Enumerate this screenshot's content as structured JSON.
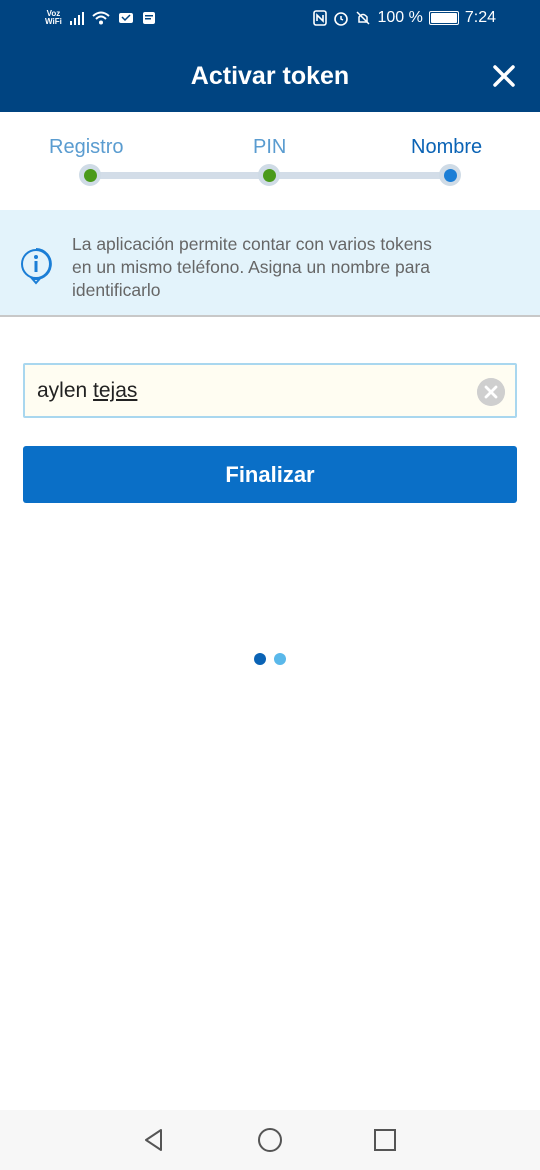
{
  "status_bar": {
    "carrier_label_1": "Voz",
    "carrier_label_2": "WiFi",
    "battery": "100 %",
    "time": "7:24"
  },
  "header": {
    "title": "Activar token",
    "close_icon": "close-icon"
  },
  "stepper": {
    "steps": [
      {
        "label": "Registro",
        "state": "done",
        "color": "#4a9a1a"
      },
      {
        "label": "PIN",
        "state": "done",
        "color": "#4a9a1a"
      },
      {
        "label": "Nombre",
        "state": "current",
        "color": "#1b7ed6"
      }
    ]
  },
  "info": {
    "icon": "info-icon",
    "message_line1": "La aplicación permite contar con varios tokens",
    "message_line2": "en un mismo teléfono. Asigna un nombre para",
    "message_line3": "identificarlo"
  },
  "name_field": {
    "value_word1": "aylen",
    "value_word2": "tejas",
    "clear_icon": "clear-icon"
  },
  "finalize_button": {
    "label": "Finalizar"
  },
  "loader": {
    "dots": [
      "#0a63b5",
      "#5ab8ea"
    ]
  },
  "nav": {
    "back_icon": "back-icon",
    "home_icon": "home-icon",
    "recents_icon": "recents-icon"
  },
  "colors": {
    "primary": "#004481",
    "button": "#0a6fc7",
    "info_bg": "#e3f3fb"
  }
}
